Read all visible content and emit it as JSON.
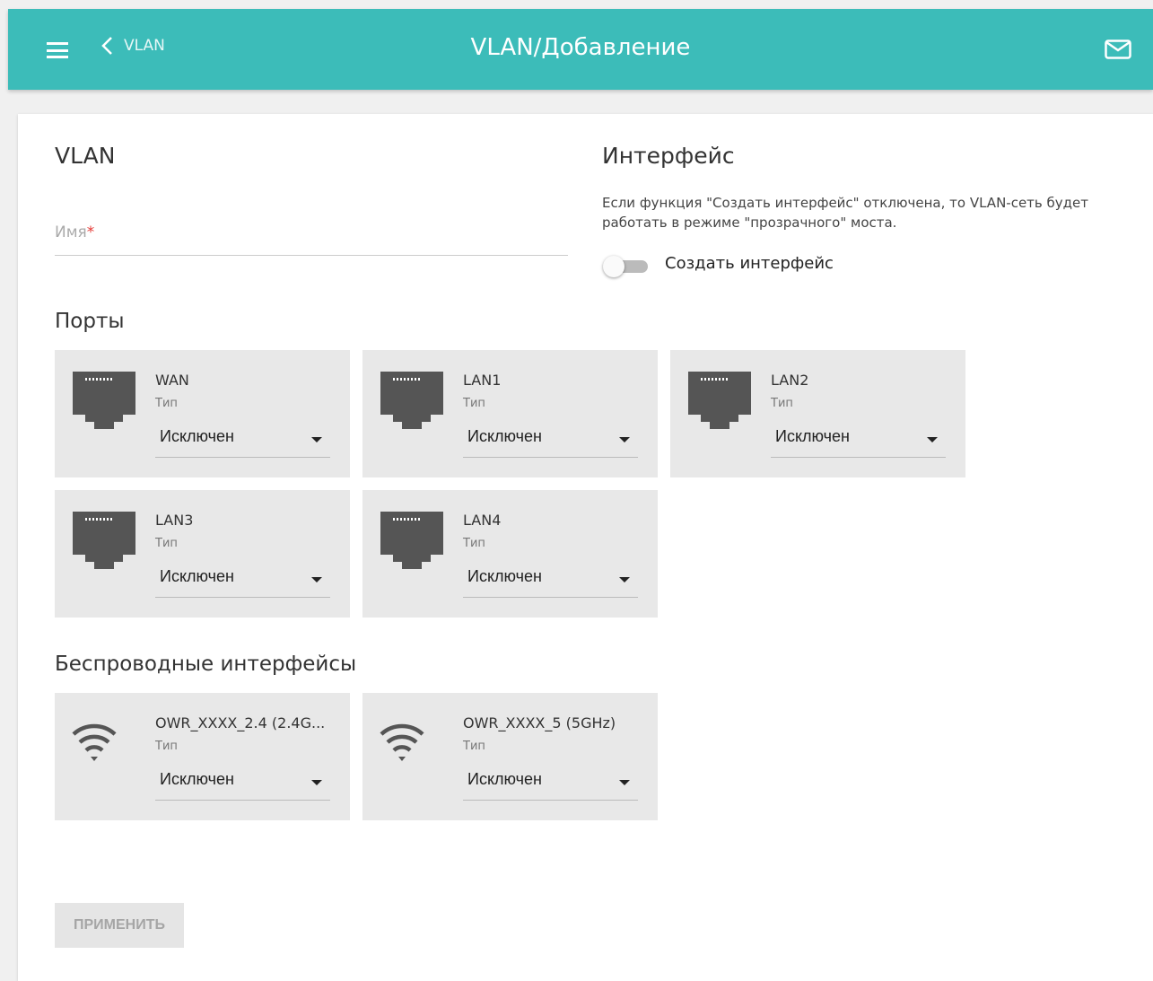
{
  "header": {
    "back_label": "VLAN",
    "title": "VLAN/Добавление",
    "accent_color": "#3cbcb9"
  },
  "vlan_section": {
    "title": "VLAN",
    "name_label": "Имя",
    "name_required_mark": "*",
    "name_value": ""
  },
  "interface_section": {
    "title": "Интерфейс",
    "hint": "Если функция \"Создать интерфейс\" отключена, то VLAN-сеть будет работать в режиме \"прозрачного\" моста.",
    "toggle_label": "Создать интерфейс",
    "toggle_on": false
  },
  "ports_section": {
    "title": "Порты",
    "ports": [
      {
        "name": "WAN",
        "type_label": "Тип",
        "value": "Исключен",
        "icon": "ethernet-port-icon"
      },
      {
        "name": "LAN1",
        "type_label": "Тип",
        "value": "Исключен",
        "icon": "ethernet-port-icon"
      },
      {
        "name": "LAN2",
        "type_label": "Тип",
        "value": "Исключен",
        "icon": "ethernet-port-icon"
      },
      {
        "name": "LAN3",
        "type_label": "Тип",
        "value": "Исключен",
        "icon": "ethernet-port-icon"
      },
      {
        "name": "LAN4",
        "type_label": "Тип",
        "value": "Исключен",
        "icon": "ethernet-port-icon"
      }
    ]
  },
  "wireless_section": {
    "title": "Беспроводные интерфейсы",
    "interfaces": [
      {
        "name": "OWR_XXXX_2.4 (2.4G...",
        "type_label": "Тип",
        "value": "Исключен",
        "icon": "wifi-icon"
      },
      {
        "name": "OWR_XXXX_5 (5GHz)",
        "type_label": "Тип",
        "value": "Исключен",
        "icon": "wifi-icon"
      }
    ]
  },
  "actions": {
    "apply_label": "ПРИМЕНИТЬ"
  }
}
